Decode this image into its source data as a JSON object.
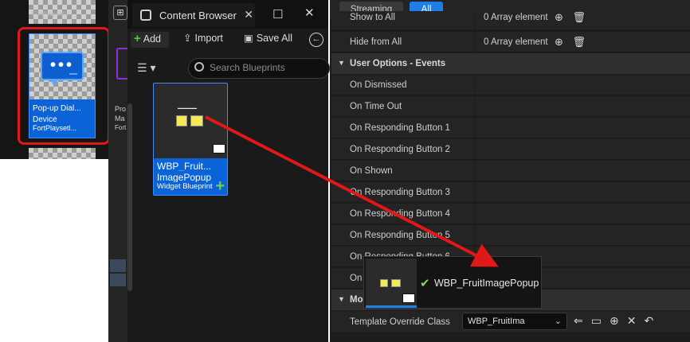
{
  "left_panel": {
    "top_tile_label": "FortPlaysetl...",
    "selected_asset": {
      "line1": "Pop-up Dial...",
      "line2": "Device",
      "line3": "FortPlaysetl..."
    }
  },
  "content_browser": {
    "tab_title": "Content Browser",
    "toolbar": {
      "add_label": "Add",
      "import_label": "Import",
      "save_all_label": "Save All"
    },
    "search_placeholder": "Search Blueprints",
    "fragment_labels": [
      "Pro",
      "Ma",
      "Fort"
    ],
    "asset": {
      "name_line1": "WBP_Fruit...",
      "name_line2": "ImagePopup",
      "type": "Widget Blueprint"
    }
  },
  "details": {
    "filters": [
      {
        "label": "Streaming",
        "active": false
      },
      {
        "label": "All",
        "active": true
      }
    ],
    "rows_top": [
      {
        "name": "Show to All",
        "value": "0 Array element"
      },
      {
        "name": "Hide from All",
        "value": "0 Array element"
      }
    ],
    "section_events": "User Options - Events",
    "event_rows": [
      "On Dismissed",
      "On Time Out",
      "On Responding Button 1",
      "On Responding Button 2",
      "On Shown",
      "On Responding Button 3",
      "On Responding Button 4",
      "On Responding Button 5",
      "On Responding Button 6",
      "On"
    ],
    "section_modify": "Mo",
    "template_row": {
      "name": "Template Override Class",
      "value": "WBP_FruitIma"
    }
  },
  "drag_ghost": {
    "label": "WBP_FruitImagePopup"
  },
  "colors": {
    "selection_blue": "#0a64d8",
    "annotation_red": "#e01818",
    "active_chip": "#1e7de6"
  }
}
